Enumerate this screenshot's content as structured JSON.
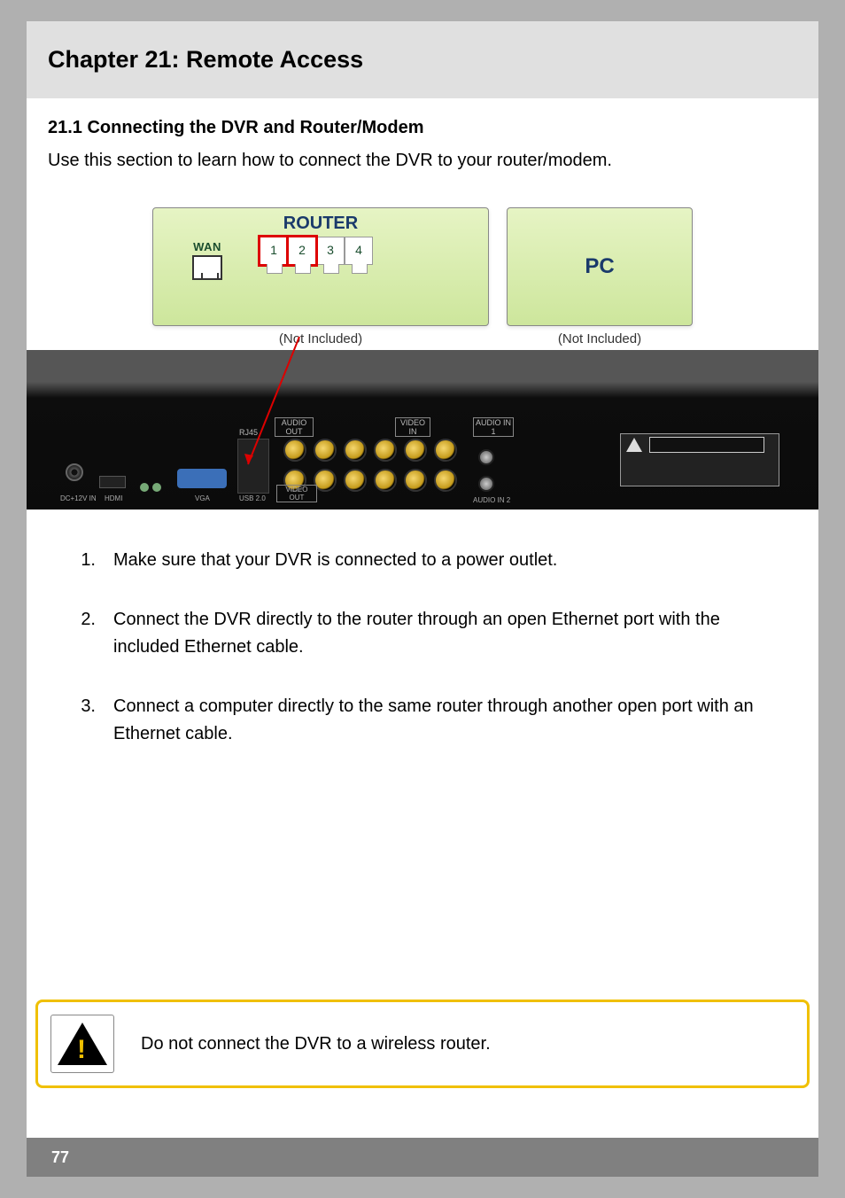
{
  "chapter": {
    "title": "Chapter 21: Remote Access"
  },
  "section": {
    "title": "21.1 Connecting the DVR and Router/Modem"
  },
  "intro": "Use this section to learn how to connect the DVR to your router/modem.",
  "diagram": {
    "router_label": "ROUTER",
    "wan_label": "WAN",
    "ports": [
      "1",
      "2",
      "3",
      "4"
    ],
    "pc_label": "PC",
    "not_included": "(Not Included)"
  },
  "dvr_labels": {
    "rj45": "RJ45",
    "audio_out": "AUDIO OUT",
    "video_in": "VIDEO IN",
    "audio_in1": "AUDIO IN 1",
    "video_out": "VIDEO OUT",
    "audio_in2": "AUDIO IN 2",
    "vga": "VGA",
    "usb": "USB 2.0",
    "hdmi": "HDMI",
    "dc": "DC+12V IN",
    "caution": "CAUTION"
  },
  "steps": [
    {
      "num": "1.",
      "text": "Make sure that your DVR is connected to a power outlet."
    },
    {
      "num": "2.",
      "text": "Connect the DVR directly to the router through an open Ethernet port with the included Ethernet cable."
    },
    {
      "num": "3.",
      "text": "Connect a computer directly to the same router through another open port with an Ethernet cable."
    }
  ],
  "warning": "Do not connect the DVR to a wireless router.",
  "page_number": "77"
}
